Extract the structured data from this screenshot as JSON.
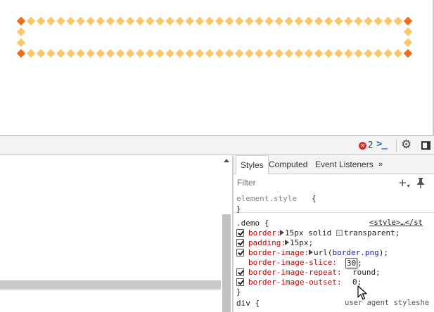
{
  "preview": {
    "demo_colors": {
      "diamond": "#fdc66b",
      "corner": "#f26b18"
    }
  },
  "toolbar": {
    "error_count": "2",
    "error_icon": "close-x-icon",
    "console_icon": "console-prompt-icon",
    "settings_icon": "gear-icon",
    "dock_icon": "dock-side-icon"
  },
  "sidebar": {
    "tabs": [
      {
        "label": "Styles"
      },
      {
        "label": "Computed"
      },
      {
        "label": "Event Listeners"
      },
      {
        "label": "»"
      }
    ],
    "filter_placeholder": "Filter",
    "add_rule_symbol": "+",
    "rules": {
      "element_style": {
        "selector": "element.style",
        "open": "{",
        "close": "}"
      },
      "demo": {
        "selector": ".demo {",
        "source": "<style>…</st",
        "declarations": [
          {
            "prop": "border:",
            "value_pre": "15px solid ",
            "value_post": "transparent;"
          },
          {
            "prop": "padding:",
            "value_pre": "15px;"
          },
          {
            "prop": "border-image:",
            "value_pre": "url(",
            "link": "border.png",
            "value_post": ");"
          },
          {
            "prop": "border-image-slice:",
            "editing": "30",
            "value_post": ";"
          },
          {
            "prop": "border-image-repeat:",
            "value_pre": "round;"
          },
          {
            "prop": "border-image-outset:",
            "value_pre": "0;"
          }
        ],
        "close": "}"
      },
      "div": {
        "selector": "div {",
        "source": "user agent styleshe"
      }
    }
  }
}
